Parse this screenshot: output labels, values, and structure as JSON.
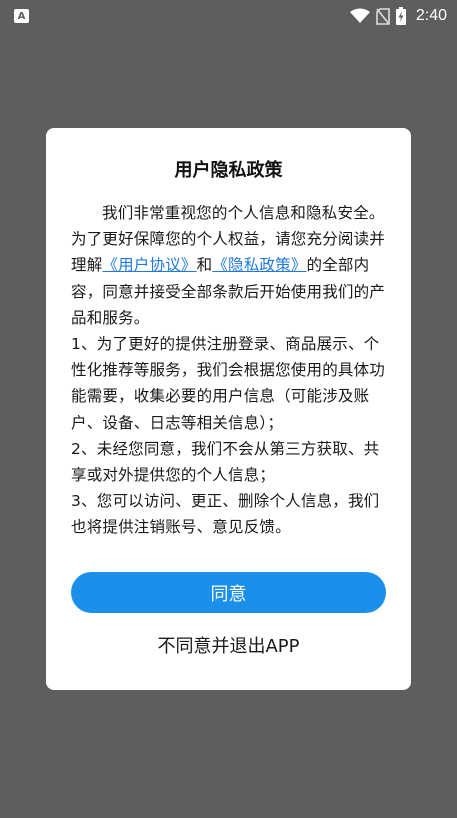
{
  "status_bar": {
    "time": "2:40",
    "notification_icon": "A",
    "icons": [
      "wifi-icon",
      "no-sim-icon",
      "battery-charging-icon"
    ]
  },
  "dialog": {
    "title": "用户隐私政策",
    "intro_part1": "我们非常重视您的个人信息和隐私安全。为了更好保障您的个人权益，请您充分阅读并理解",
    "link_user_agreement": "《用户协议》",
    "and": "和",
    "link_privacy_policy": "《隐私政策》",
    "intro_part2": "的全部内容，同意并接受全部条款后开始使用我们的产品和服务。",
    "item1": "1、为了更好的提供注册登录、商品展示、个性化推荐等服务，我们会根据您使用的具体功能需要，收集必要的用户信息（可能涉及账户、设备、日志等相关信息）；",
    "item2": "2、未经您同意，我们不会从第三方获取、共享或对外提供您的个人信息；",
    "item3": "3、您可以访问、更正、删除个人信息，我们也将提供注销账号、意见反馈。",
    "agree_label": "同意",
    "disagree_label": "不同意并退出APP"
  }
}
